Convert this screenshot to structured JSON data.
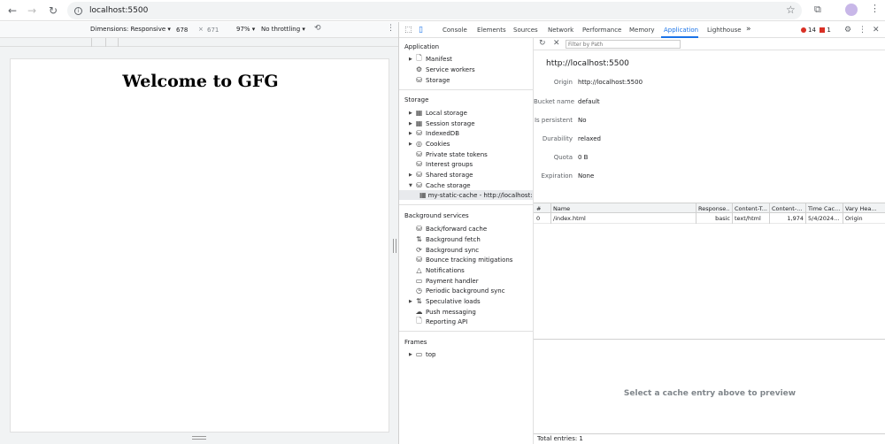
{
  "browser": {
    "url": "localhost:5500"
  },
  "emulation": {
    "dimensions_label": "Dimensions: Responsive",
    "width": "678",
    "times": "×",
    "height": "671",
    "zoom": "97%",
    "throttling": "No throttling"
  },
  "page": {
    "heading": "Welcome to GFG"
  },
  "devtools": {
    "tabs": [
      "Console",
      "Elements",
      "Sources",
      "Network",
      "Performance",
      "Memory",
      "Application",
      "Lighthouse"
    ],
    "more_tabs": "»",
    "error_count": "14",
    "issue_count": "1",
    "active_tab": "Application"
  },
  "sidebar": {
    "application_title": "Application",
    "application_items": [
      "Manifest",
      "Service workers",
      "Storage"
    ],
    "storage_title": "Storage",
    "storage_items": [
      "Local storage",
      "Session storage",
      "IndexedDB",
      "Cookies",
      "Private state tokens",
      "Interest groups",
      "Shared storage",
      "Cache storage"
    ],
    "cache_child": "my-static-cache - http://localhost:5500",
    "background_title": "Background services",
    "background_items": [
      "Back/forward cache",
      "Background fetch",
      "Background sync",
      "Bounce tracking mitigations",
      "Notifications",
      "Payment handler",
      "Periodic background sync",
      "Speculative loads",
      "Push messaging",
      "Reporting API"
    ],
    "frames_title": "Frames",
    "frames_items": [
      "top"
    ]
  },
  "main": {
    "filter_placeholder": "Filter by Path",
    "origin_title": "http://localhost:5500",
    "fields": [
      {
        "key": "Origin",
        "value": "http://localhost:5500"
      },
      {
        "key": "Bucket name",
        "value": "default"
      },
      {
        "key": "Is persistent",
        "value": "No"
      },
      {
        "key": "Durability",
        "value": "relaxed"
      },
      {
        "key": "Quota",
        "value": "0 B"
      },
      {
        "key": "Expiration",
        "value": "None"
      }
    ],
    "table": {
      "headers": [
        "#",
        "Name",
        "Response...",
        "Content-T...",
        "Content-...",
        "Time Cac...",
        "Vary Hea..."
      ],
      "rows": [
        [
          "0",
          "/index.html",
          "basic",
          "text/html",
          "1,974",
          "5/4/2024...",
          "Origin"
        ]
      ]
    },
    "preview_message": "Select a cache entry above to preview",
    "total_entries": "Total entries: 1"
  }
}
